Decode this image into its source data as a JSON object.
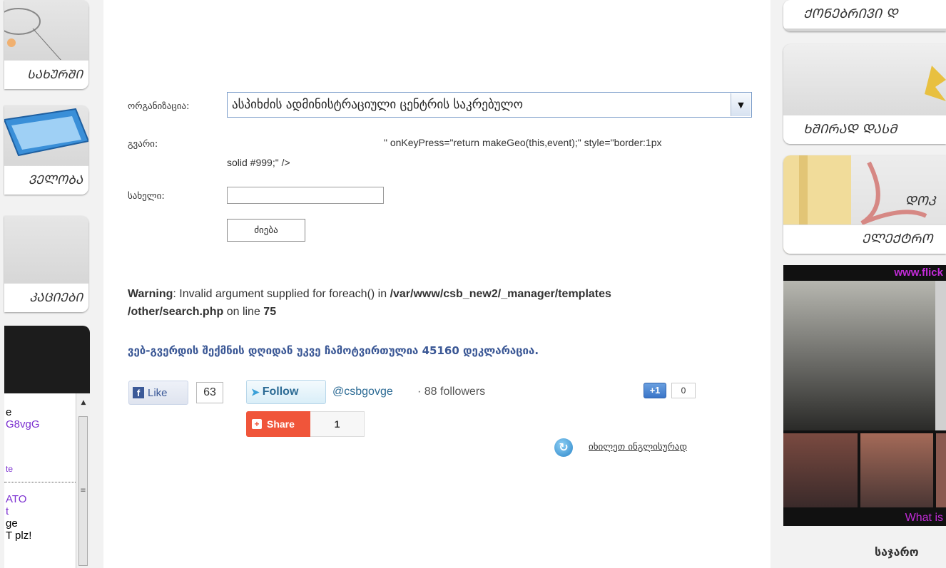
{
  "left_sidebar": {
    "boxes": [
      {
        "label": "ᲡᲐᲮᲣᲠᲨᲘ"
      },
      {
        "label": "ᲕᲔᲚᲝᲑᲐ"
      },
      {
        "label": "ᲙᲐᲪᲘᲔᲑᲘ"
      }
    ],
    "chat_lines": [
      "e",
      "G8vgG",
      "te",
      "ATO",
      "t",
      "ge",
      "T plz!"
    ],
    "chat_colors": [
      "#000000",
      "#7b2fd0",
      "#7b2fd0",
      "#7b2fd0",
      "#7b2fd0",
      "#000000",
      "#000000"
    ]
  },
  "form": {
    "org_label": "ორგანიზაცია:",
    "org_value": "ასპიხძის ადმინისტრაციული ცენტრის საკრებულო",
    "surname_label": "გვარი:",
    "raw_line1": "\" onKeyPress=\"return makeGeo(this,event);\" style=\"border:1px",
    "raw_line2": "solid #999;\" />",
    "name_label": "სახელი:",
    "name_value": "",
    "search_button": "ძიება"
  },
  "warning": {
    "prefix": "Warning",
    "text": ": Invalid argument supplied for foreach() in ",
    "path1": "/var/www/csb_new2/_manager/templates",
    "path2": "/other/search.php",
    "online": " on line ",
    "line": "75"
  },
  "declaration": "ვებ-გვერდის შექმნის დღიდან უკვე ჩამოტვირთულია 45160 დეკლარაცია.",
  "social": {
    "fb_icon": "f",
    "fb_like": "Like",
    "fb_count": "63",
    "tw_follow": "Follow",
    "tw_handle": "@csbgovge",
    "tw_followers": "· 88 followers",
    "gplus": "+1",
    "gplus_count": "0",
    "share_label": "Share",
    "share_count": "1",
    "english_link": "იხილეთ ინგლისურად"
  },
  "right_sidebar": {
    "boxes": [
      {
        "label": "ᲥᲝᲜᲔᲑᲠᲘᲕᲘ Დ"
      },
      {
        "label": "ᲮᲨᲘᲠᲐᲓ ᲓᲐᲡᲛ"
      },
      {
        "label": "ᲓᲝᲙ"
      },
      {
        "label": "ᲔᲚᲔᲥᲢᲠᲝ"
      }
    ],
    "flickr_top": "www.flick",
    "flickr_bottom": "What is",
    "footer": "საჯარო"
  },
  "icons": {
    "dropdown": "chevron-down-icon",
    "twitter": "twitter-bird-icon",
    "share": "share-plus-icon",
    "english": "refresh-icon"
  },
  "colors": {
    "link_blue": "#3a5795",
    "share_orange": "#f0553a",
    "flickr_magenta": "#c22bd8"
  }
}
